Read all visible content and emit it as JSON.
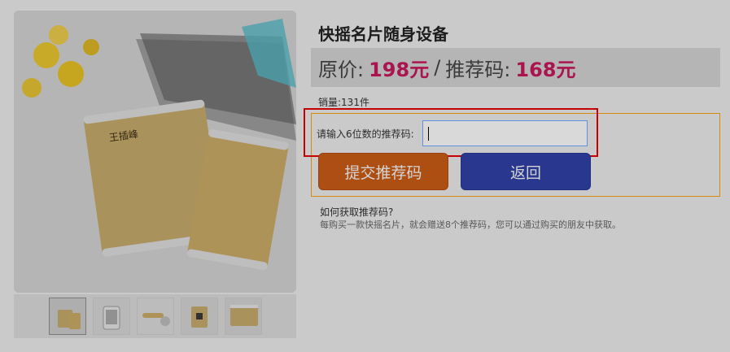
{
  "product": {
    "title": "快摇名片随身设备",
    "price": {
      "original_label": "原价:",
      "original_value": "198元",
      "separator": "/",
      "promo_label": "推荐码:",
      "promo_value": "168元"
    },
    "sales_text": "销量:131件"
  },
  "form": {
    "code_label": "请输入6位数的推荐码:",
    "code_value": "",
    "submit_label": "提交推荐码",
    "back_label": "返回"
  },
  "help": {
    "title": "如何获取推荐码?",
    "text": "每购买一款快摇名片，就会赠送8个推荐码，您可以通过购买的朋友中获取。"
  },
  "colors": {
    "accent_red": "#c2185b",
    "submit_orange": "#c55a16",
    "back_blue": "#2f3fa3",
    "panel_orange": "#f39c12",
    "focus_red": "#e00000"
  },
  "icons": {
    "main_image": "product-photo-icon",
    "thumbnails": [
      "thumbnail-1",
      "thumbnail-2",
      "thumbnail-3",
      "thumbnail-4",
      "thumbnail-5"
    ]
  }
}
